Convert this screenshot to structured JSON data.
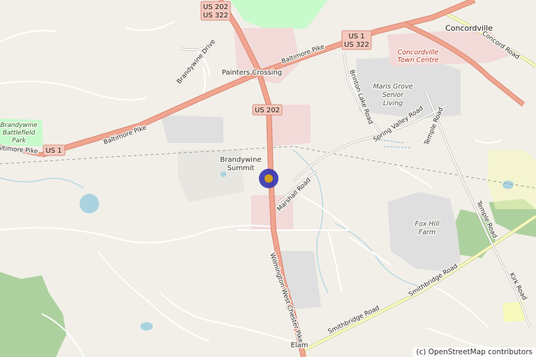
{
  "map": {
    "attribution": "(c) OpenStreetMap contributors",
    "colors": {
      "background": "#f2efe9",
      "primary_road": "#f0a590",
      "primary_road_casing": "#d98570",
      "secondary_road": "#f6fabb",
      "minor_road": "#ffffff",
      "forest": "#add19e",
      "park": "#c8facc",
      "water": "#aad3df",
      "commercial": "#f2dad9",
      "residential": "#e0dfdf",
      "marker_outer": "#3434b0",
      "marker_inner": "#d4a017"
    },
    "places": {
      "concordville": "Concordville",
      "painters_crossing": "Painters Crossing",
      "brandywine_summit_line1": "Brandywine",
      "brandywine_summit_line2": "Summit",
      "elam": "Elam",
      "brandywine_park_line1": "Brandywine",
      "brandywine_park_line2": "Battlefield",
      "brandywine_park_line3": "Park",
      "concordville_centre_line1": "Concordville",
      "concordville_centre_line2": "Town Centre",
      "maris_grove_line1": "Maris Grove",
      "maris_grove_line2": "Senior",
      "maris_grove_line3": "Living",
      "fox_hill_line1": "Fox Hill",
      "fox_hill_line2": "Farm"
    },
    "roads": {
      "baltimore_pike": "Baltimore Pike",
      "baltimore_pike_west": "Baltimore Pike",
      "baltimore_pike_east": "Baltimore Pike",
      "brandywine_drive": "Brandywine Drive",
      "brinton_lake_road": "Brinton Lake Road",
      "spring_valley_road": "Spring Valley Road",
      "temple_road_north": "Temple Road",
      "temple_road_south": "Temple Road",
      "concord_road": "Concord Road",
      "marshall_road": "Marshall Road",
      "wilmington_west_chester_pike": "Wilmington West Chester Pike",
      "smithbridge_road": "Smithbridge Road",
      "kirk_road": "Kirk Road"
    },
    "shields": {
      "us202_north_line1": "US 202",
      "us202_north_line2": "US 322",
      "us1_east_line1": "US 1",
      "us1_east_line2": "US 322",
      "us202_center": "US 202",
      "us1_west": "US 1"
    }
  }
}
